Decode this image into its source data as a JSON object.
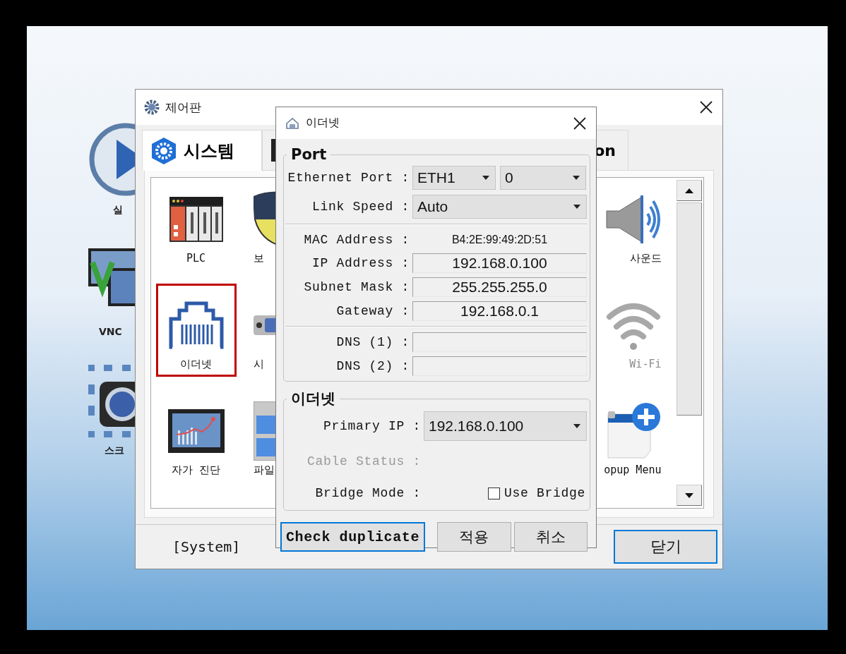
{
  "desktop": {
    "icons": [
      {
        "kind": "play",
        "label": "실"
      },
      {
        "kind": "vnc",
        "label": "VNC"
      },
      {
        "kind": "capture",
        "label": "스크"
      }
    ]
  },
  "control_panel": {
    "title": "제어판",
    "tabs": [
      {
        "label": "시스템",
        "selected": true
      },
      {
        "selected": false
      },
      {
        "label": "on",
        "selected": false
      }
    ],
    "item_rows": [
      [
        {
          "kind": "plc",
          "label": "PLC",
          "selected": false,
          "disabled": false
        },
        {
          "kind": "shield",
          "label": "보",
          "selected": false,
          "disabled": false
        },
        {
          "kind": "speaker",
          "label": "사운드",
          "selected": false,
          "disabled": false
        }
      ],
      [
        {
          "kind": "ethernet",
          "label": "이더넷",
          "selected": true,
          "disabled": false
        },
        {
          "kind": "serial",
          "label": "시",
          "selected": false,
          "disabled": false
        },
        {
          "kind": "wifi",
          "label": "Wi-Fi",
          "selected": false,
          "disabled": true
        }
      ],
      [
        {
          "kind": "chart",
          "label": "자가 진단",
          "selected": false,
          "disabled": false
        },
        {
          "kind": "cabinet",
          "label": "파일",
          "selected": false,
          "disabled": false
        },
        {
          "kind": "popup",
          "label": "opup Menu",
          "selected": false,
          "disabled": false
        }
      ]
    ],
    "status": "[System]",
    "buttons": [
      {
        "label": "닫기",
        "focused": true
      }
    ]
  },
  "ethernet_dialog": {
    "title": "이더넷",
    "port_group": {
      "title": "Port",
      "rows": [
        {
          "kind": "dropdown_pair",
          "label": "Ethernet Port :",
          "value": "ETH1",
          "value_2": "0"
        },
        {
          "kind": "dropdown",
          "label": "Link Speed :",
          "value": "Auto"
        },
        {
          "kind": "separator"
        },
        {
          "kind": "static",
          "label": "MAC Address :",
          "value": "B4:2E:99:49:2D:51"
        },
        {
          "kind": "field",
          "label": "IP Address :",
          "value": "192.168.0.100"
        },
        {
          "kind": "field",
          "label": "Subnet Mask :",
          "value": "255.255.255.0"
        },
        {
          "kind": "field",
          "label": "Gateway :",
          "value": "192.168.0.1"
        },
        {
          "kind": "separator"
        },
        {
          "kind": "field",
          "label": "DNS (1) :"
        },
        {
          "kind": "field",
          "label": "DNS (2) :"
        }
      ]
    },
    "ethernet_group": {
      "title": "이더넷",
      "rows": [
        {
          "kind": "dropdown",
          "label": "Primary IP :",
          "value": "192.168.0.100",
          "disabled": false
        },
        {
          "kind": "static",
          "label": "Cable Status :",
          "disabled": true
        },
        {
          "kind": "checkbox",
          "label": "Bridge Mode :",
          "option": "Use Bridge",
          "checked": false,
          "disabled": false
        }
      ]
    },
    "buttons": [
      {
        "label": "Check duplicate",
        "focused": true
      },
      {
        "label": "적용",
        "focused": false
      },
      {
        "label": "취소",
        "focused": false
      }
    ]
  }
}
